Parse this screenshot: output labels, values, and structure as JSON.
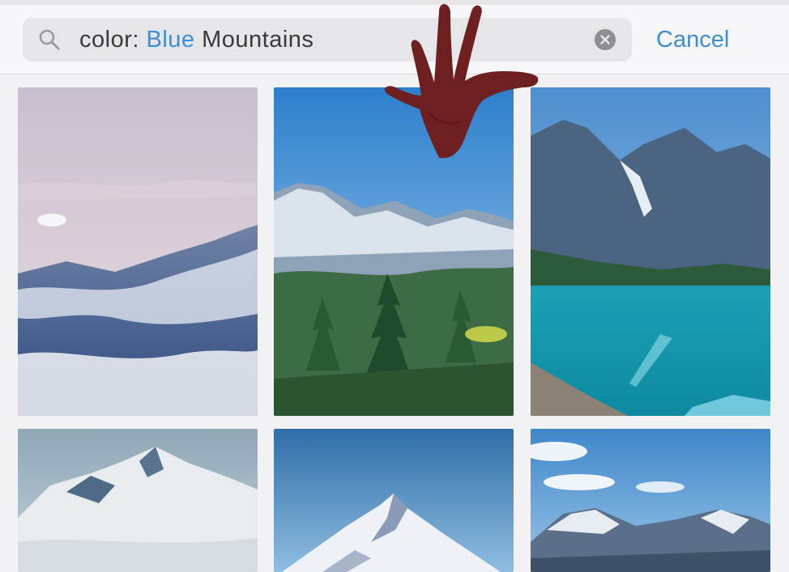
{
  "search": {
    "query_prefix": "color:",
    "query_token": "Blue",
    "query_text": "Mountains",
    "search_icon": "magnifier-icon",
    "clear_icon": "clear-circle-icon",
    "cancel_label": "Cancel"
  },
  "colors": {
    "accent": "#3a8fd6",
    "field_bg": "#e5e5ea",
    "background": "#f2f2f4"
  },
  "results": [
    {
      "subject": "misty mountain peak with clouds, purple sky"
    },
    {
      "subject": "snowy ridge above evergreen forest, blue sky"
    },
    {
      "subject": "turquoise lake below rocky mountains"
    },
    {
      "subject": "snow-covered summit under pale sky"
    },
    {
      "subject": "snowy pointed peak, deep blue sky"
    },
    {
      "subject": "snowy mountain range with white clouds"
    }
  ]
}
